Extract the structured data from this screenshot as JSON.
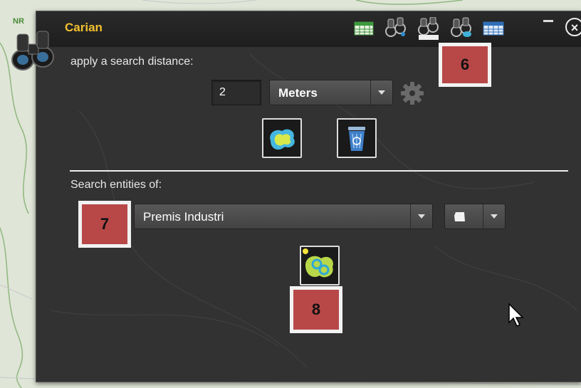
{
  "window": {
    "title": "Carian",
    "close_glyph": "×",
    "map_label": "NR",
    "toolbar_icons": [
      "table-icon",
      "binoculars-search-icon",
      "binoculars-attribute-icon",
      "binoculars-spatial-icon",
      "grid-table-icon"
    ]
  },
  "distance": {
    "label": "apply a search distance:",
    "value": "2",
    "unit_selected": "Meters"
  },
  "entities": {
    "label": "Search entities of:",
    "layer_selected": "Premis Industri"
  },
  "markers": {
    "m6": "6",
    "m7": "7",
    "m8": "8"
  },
  "colors": {
    "panel_bg": "#323232",
    "title": "#f2c12e",
    "marker_bg": "#b84848",
    "marker_border": "#f2f2f2"
  }
}
